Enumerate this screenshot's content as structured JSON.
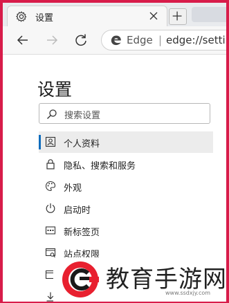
{
  "tab": {
    "title": "设置"
  },
  "toolbar": {
    "address_label": "Edge",
    "address_separator": "|",
    "address_url": "edge://settin"
  },
  "page": {
    "title": "设置",
    "search_placeholder": "搜索设置"
  },
  "nav_items": [
    {
      "label": "个人资料",
      "icon": "profile-icon",
      "selected": true
    },
    {
      "label": "隐私、搜索和服务",
      "icon": "lock-icon"
    },
    {
      "label": "外观",
      "icon": "palette-icon"
    },
    {
      "label": "启动时",
      "icon": "power-icon"
    },
    {
      "label": "新标签页",
      "icon": "new-tab-page-icon"
    },
    {
      "label": "站点权限",
      "icon": "site-permissions-icon"
    },
    {
      "label": "",
      "icon": "browser-icon"
    },
    {
      "label": "",
      "icon": "download-icon"
    }
  ],
  "watermark": {
    "text": "教育手游网",
    "url": "www.ssdxjy.com"
  },
  "colors": {
    "frame": "#d81c4a",
    "accent": "#0f6cbd",
    "watermark_red": "#e8202f"
  }
}
